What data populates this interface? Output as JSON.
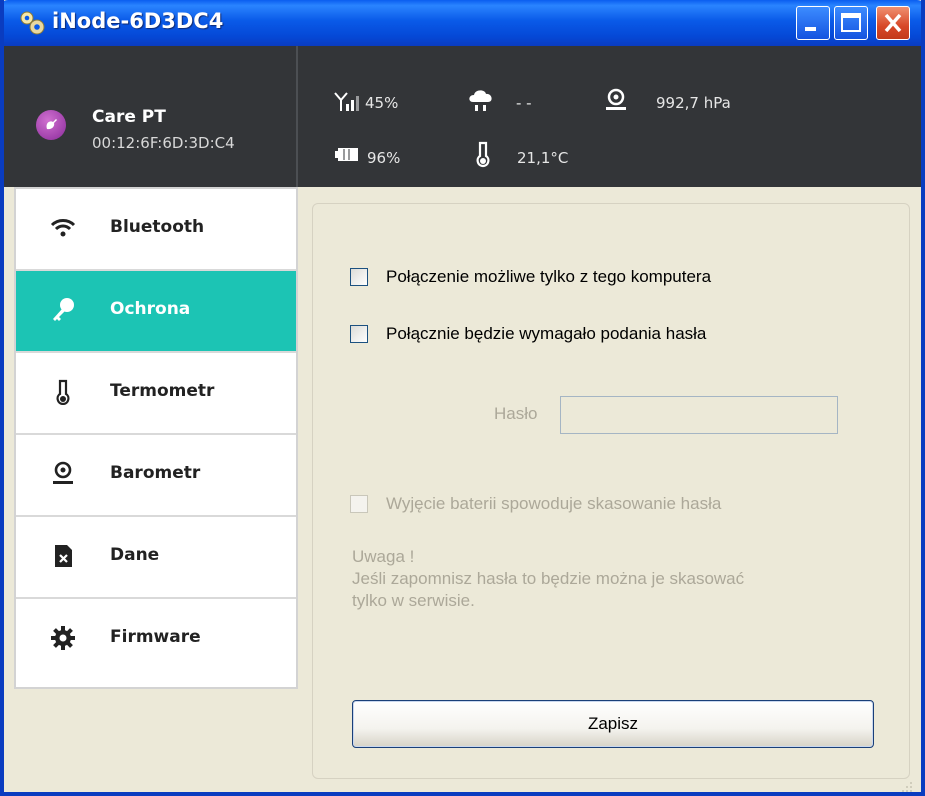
{
  "window": {
    "title": "iNode-6D3DC4"
  },
  "device": {
    "name": "Care PT",
    "mac": "00:12:6F:6D:3D:C4"
  },
  "stats": {
    "signal": "45%",
    "weather": "- -",
    "pressure": "992,7 hPa",
    "battery": "96%",
    "temperature": "21,1°C"
  },
  "sidebar": {
    "items": [
      {
        "label": "Bluetooth",
        "icon": "wifi-icon"
      },
      {
        "label": "Ochrona",
        "icon": "key-icon",
        "active": true
      },
      {
        "label": "Termometr",
        "icon": "thermometer-icon"
      },
      {
        "label": "Barometr",
        "icon": "barometer-icon"
      },
      {
        "label": "Dane",
        "icon": "data-file-icon"
      },
      {
        "label": "Firmware",
        "icon": "gear-icon"
      }
    ]
  },
  "security": {
    "option1": "Połączenie możliwe tylko z tego komputera",
    "option2": "Połącznie będzie wymagało podania hasła",
    "password_label": "Hasło",
    "password_value": "",
    "option3": "Wyjęcie baterii spowoduje skasowanie hasła",
    "note_line1": "Uwaga !",
    "note_line2": "Jeśli zapomnisz hasła to będzie można je skasować",
    "note_line3": "tylko w serwisie.",
    "save_label": "Zapisz"
  },
  "colors": {
    "accent": "#1cc4b4",
    "header_bg": "#333538",
    "window_bg": "#ece9d8"
  }
}
